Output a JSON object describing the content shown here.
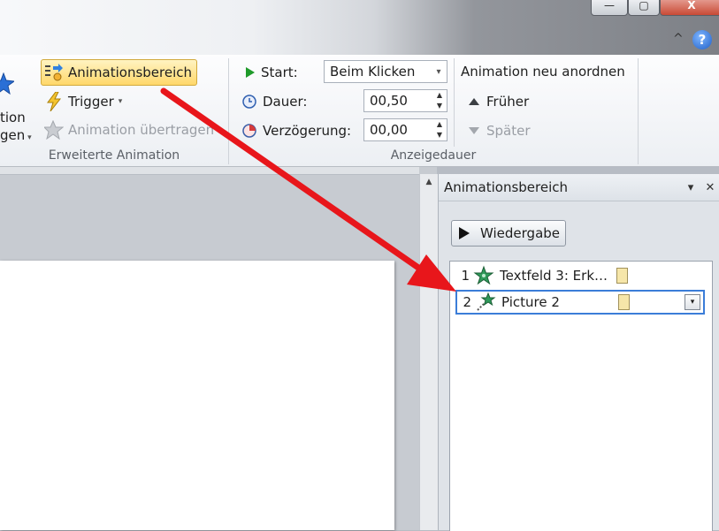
{
  "window": {
    "minimize_label": "—",
    "maximize_label": "▢",
    "close_label": "X",
    "help_label": "?",
    "ribbon_collapse_label": "^"
  },
  "ribbon": {
    "group_advanced": {
      "partial_button_line1": "tion",
      "partial_button_line2": "gen",
      "animation_pane_label": "Animationsbereich",
      "trigger_label": "Trigger",
      "animation_painter_label": "Animation übertragen",
      "group_label": "Erweiterte Animation"
    },
    "group_timing": {
      "start_label": "Start:",
      "start_value": "Beim Klicken",
      "duration_label": "Dauer:",
      "duration_value": "00,50",
      "delay_label": "Verzögerung:",
      "delay_value": "00,00",
      "reorder_title": "Animation neu anordnen",
      "earlier_label": "Früher",
      "later_label": "Später",
      "group_label": "Anzeigedauer"
    }
  },
  "animation_pane": {
    "title": "Animationsbereich",
    "play_label": "Wiedergabe",
    "items": [
      {
        "index": "1",
        "label": "Textfeld 3: Erk…",
        "selected": false
      },
      {
        "index": "2",
        "label": "Picture 2",
        "selected": true
      }
    ]
  },
  "colors": {
    "arrow": "#e8161b",
    "selection": "#3b7dd8",
    "highlight": "#ffd86a"
  }
}
